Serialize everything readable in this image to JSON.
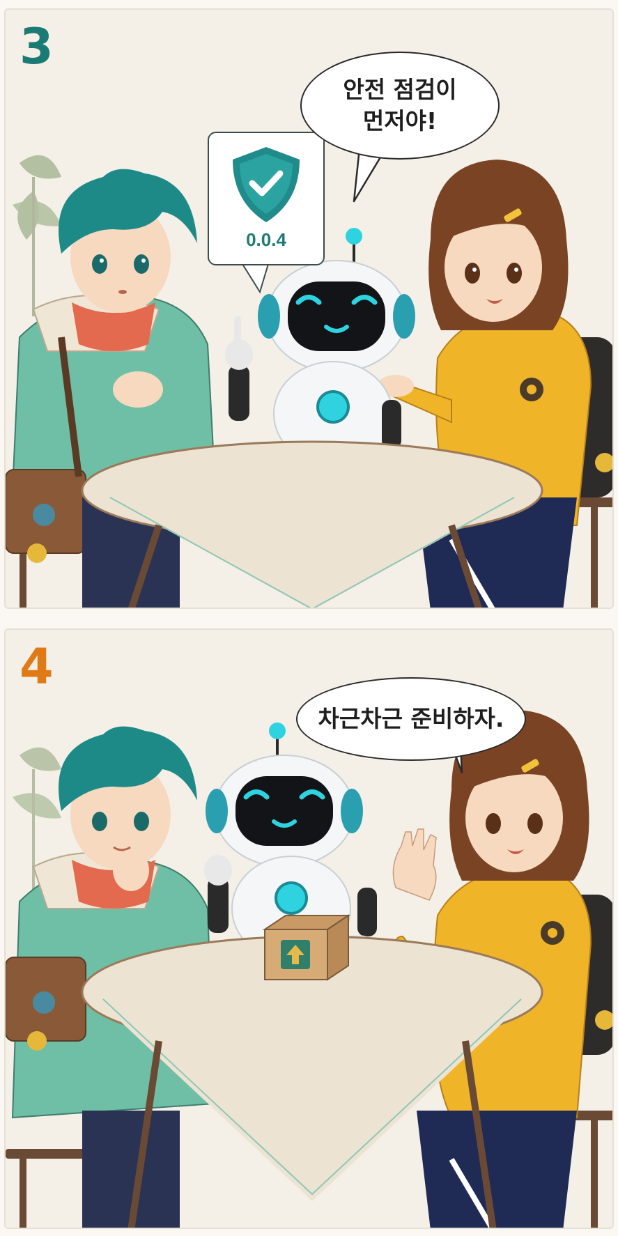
{
  "panels": [
    {
      "number": "3",
      "number_color": "#1a7a74",
      "speech": [
        "안전 점검이",
        "먼저야!"
      ],
      "badge": {
        "icon": "shield-check-icon",
        "version": "0.0.4"
      }
    },
    {
      "number": "4",
      "number_color": "#e07a16",
      "speech": [
        "차근차근 준비하자."
      ],
      "prop": {
        "icon": "box-upload-icon"
      }
    }
  ],
  "colors": {
    "teal": "#1f8b8a",
    "hoodie": "#f0b428",
    "jacket": "#6fbfa6",
    "robot_glow": "#2fd3e0"
  }
}
